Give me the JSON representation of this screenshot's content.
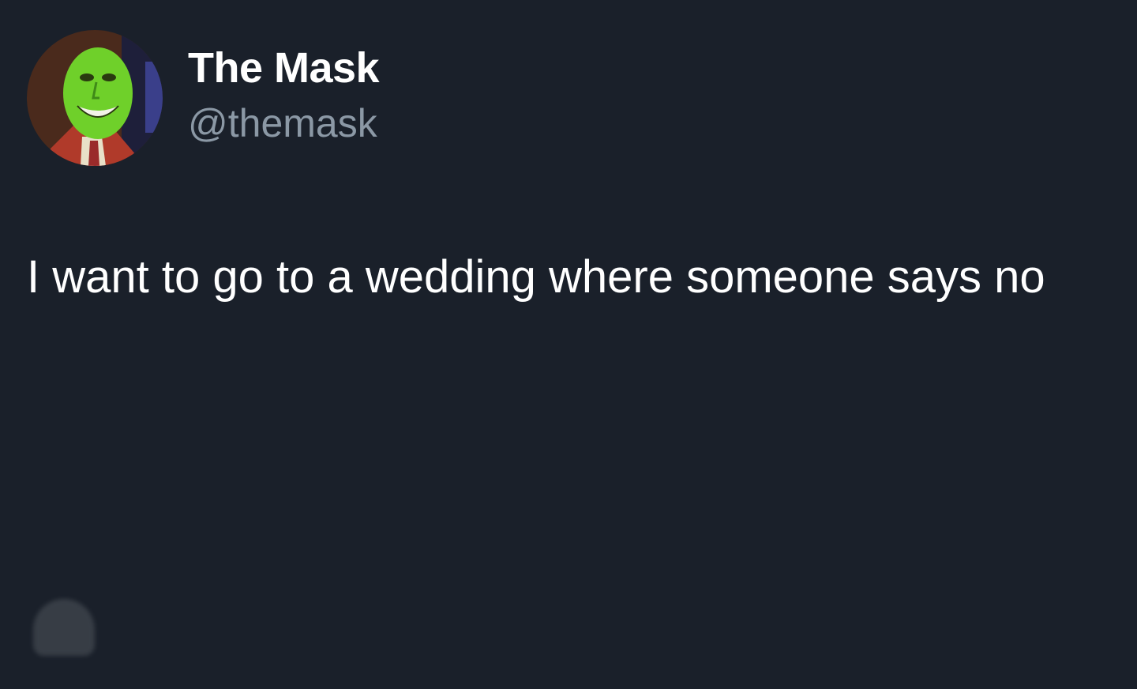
{
  "tweet": {
    "display_name": "The Mask",
    "handle": "@themask",
    "text": "I want to go to a wedding where someone says no"
  },
  "icons": {
    "avatar": "green-mask-face-avatar",
    "faded_avatar": "blurred-avatar"
  },
  "colors": {
    "background": "#1a202a",
    "name": "#ffffff",
    "handle": "#8b98a5",
    "text": "#ffffff",
    "mask_green": "#6fd02a"
  }
}
